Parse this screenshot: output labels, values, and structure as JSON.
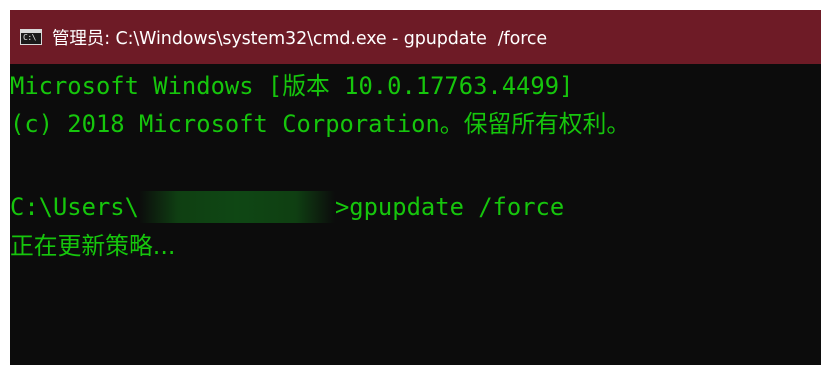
{
  "window": {
    "title": "管理员: C:\\Windows\\system32\\cmd.exe - gpupdate  /force",
    "icon_text": "C:\\",
    "colors": {
      "titlebar": "#6e1b26",
      "console_bg": "#0c0c0c",
      "console_text": "#16c60c"
    }
  },
  "console": {
    "line1": "Microsoft Windows [版本 10.0.17763.4499]",
    "line2": "(c) 2018 Microsoft Corporation。保留所有权利。",
    "prompt_prefix": "C:\\Users\\",
    "prompt_suffix": ">gpupdate /force",
    "status": "正在更新策略..."
  }
}
